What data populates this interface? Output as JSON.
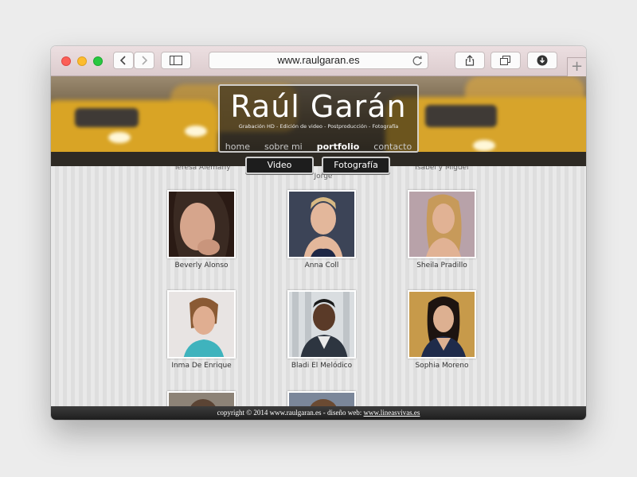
{
  "browser": {
    "url": "www.raulgaran.es",
    "new_tab": "+"
  },
  "site": {
    "brand": "Raúl Garán",
    "tagline": "Grabación HD - Edición de video - Postproducción - Fotografía",
    "nav": [
      {
        "label": "home"
      },
      {
        "label": "sobre mi"
      },
      {
        "label": "portfolio"
      },
      {
        "label": "contacto"
      }
    ],
    "tabs": {
      "video": "Video",
      "photo": "Fotografía"
    },
    "cut_names": {
      "top_center": "Teresa Alemany",
      "top_right": "Isabel y Miguel",
      "under": "Jorge"
    },
    "gallery": [
      {
        "name": "Beverly Alonso"
      },
      {
        "name": "Anna Coll"
      },
      {
        "name": "Sheila Pradillo"
      },
      {
        "name": "Inma De Enrique"
      },
      {
        "name": "Bladi El Melódico"
      },
      {
        "name": "Sophia Moreno"
      }
    ],
    "footer": {
      "text": "copyright © 2014 www.raulgaran.es - diseño web: ",
      "link": "www.lineasvivas.es"
    }
  },
  "colors": {
    "accent": "#d9a425",
    "footer_bg": "#1e1e1e"
  }
}
